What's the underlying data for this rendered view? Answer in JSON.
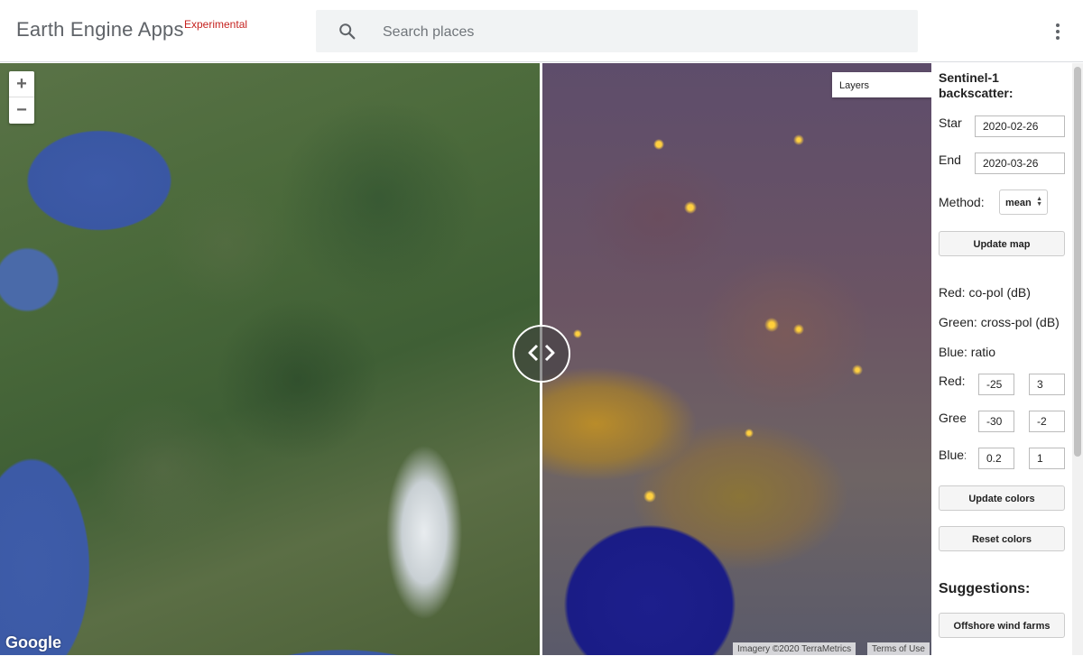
{
  "header": {
    "title": "Earth Engine Apps",
    "badge": "Experimental",
    "search_placeholder": "Search places"
  },
  "map": {
    "zoom_in": "+",
    "zoom_out": "−",
    "layers_label": "Layers",
    "google_logo": "Google",
    "attribution_imagery": "Imagery ©2020 TerraMetrics",
    "attribution_terms": "Terms of Use"
  },
  "panel": {
    "title": "Sentinel-1 backscatter:",
    "start_label": "Start",
    "start_value": "2020-02-26",
    "end_label": "End",
    "end_value": "2020-03-26",
    "method_label": "Method:",
    "method_value": "mean",
    "update_map": "Update map",
    "legend_red": "Red: co-pol (dB)",
    "legend_green": "Green: cross-pol (dB)",
    "legend_blue": "Blue: ratio",
    "red_label": "Red:",
    "red_min": "-25",
    "red_max": "3",
    "green_label": "Green:",
    "green_min": "-30",
    "green_max": "-2",
    "blue_label": "Blue:",
    "blue_min": "0.2",
    "blue_max": "1",
    "update_colors": "Update colors",
    "reset_colors": "Reset colors",
    "suggestions_title": "Suggestions:",
    "suggestion_1": "Offshore wind farms"
  }
}
